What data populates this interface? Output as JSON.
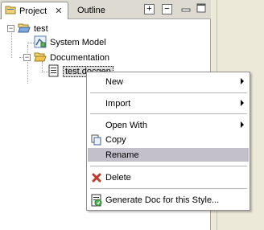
{
  "tabs": {
    "project_label": "Project",
    "project_close": "✕",
    "outline_label": "Outline",
    "expand_icon": "+",
    "collapse_icon": "−"
  },
  "tree": {
    "root": "test",
    "system_model": "System Model",
    "documentation": "Documentation",
    "docgen_file": "test.docgen",
    "expanded_glyph": "−"
  },
  "menu": {
    "new": "New",
    "import": "Import",
    "open_with": "Open With",
    "copy": "Copy",
    "rename": "Rename",
    "delete": "Delete",
    "generate": "Generate Doc for this Style..."
  },
  "colors": {
    "highlight": "#c3c0cb",
    "delete_icon": "#c0392b",
    "folder": "#e8c15a"
  }
}
